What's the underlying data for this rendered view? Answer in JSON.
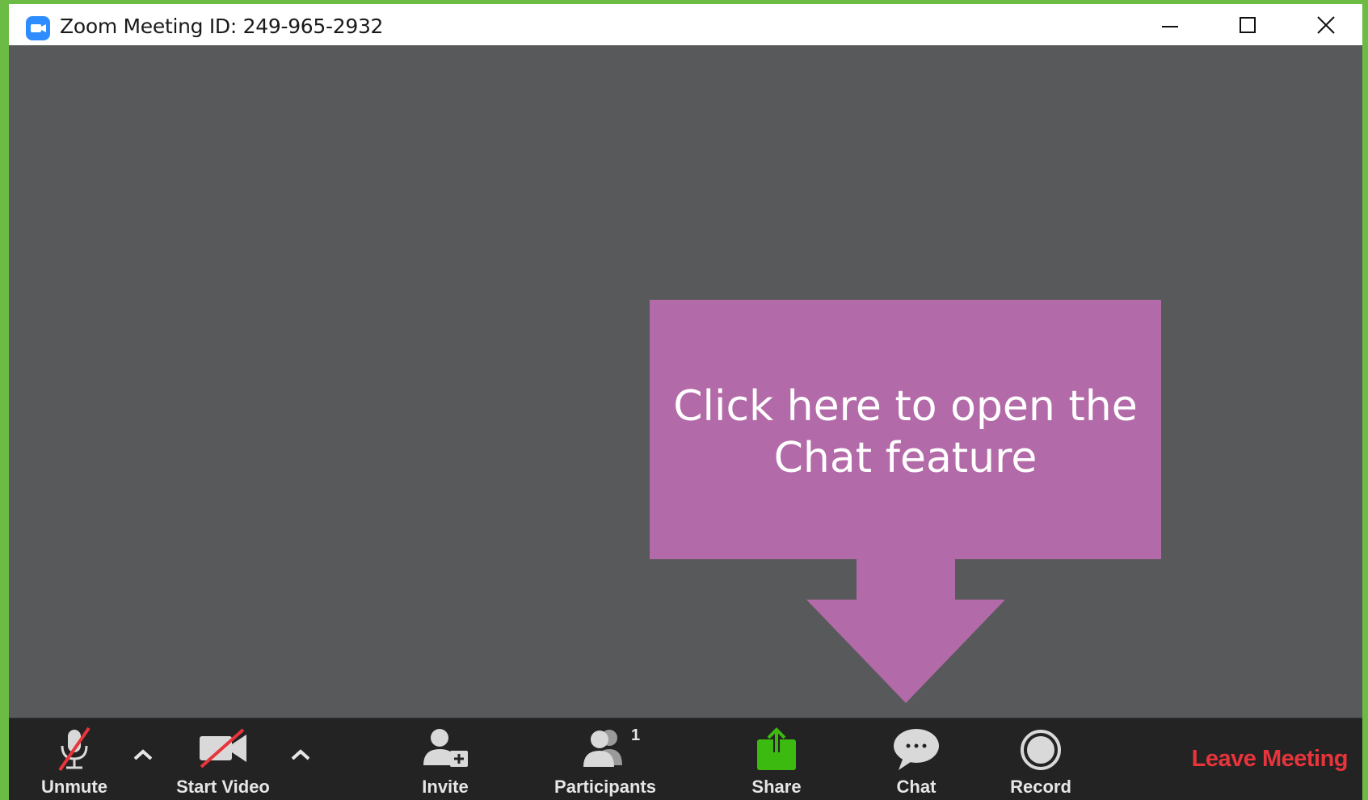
{
  "window": {
    "title": "Zoom Meeting ID: 249-965-2932",
    "controls": {
      "minimize_icon": "minimize-icon",
      "maximize_icon": "maximize-icon",
      "close_icon": "close-icon"
    }
  },
  "callout": {
    "line1": "Click here to open the",
    "line2": "Chat feature",
    "color": "#b36aa8"
  },
  "toolbar": {
    "unmute_label": "Unmute",
    "start_video_label": "Start Video",
    "invite_label": "Invite",
    "participants_label": "Participants",
    "participants_count": "1",
    "share_label": "Share",
    "chat_label": "Chat",
    "record_label": "Record",
    "leave_label": "Leave Meeting"
  },
  "colors": {
    "frame_green": "#6cbb45",
    "stage_gray": "#58595b",
    "toolbar_dark": "#232323",
    "share_green": "#3dba0f",
    "leave_red": "#e8343b",
    "mute_slash_red": "#e8343b"
  }
}
